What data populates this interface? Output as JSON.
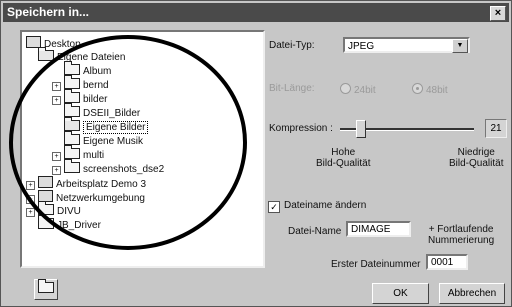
{
  "window": {
    "title": "Speichern in...",
    "close_glyph": "×"
  },
  "tree": {
    "items": [
      {
        "label": "Desktop",
        "icon": "desktop-icon"
      },
      {
        "label": "Eigene Dateien",
        "icon": "folder-open-icon"
      },
      {
        "label": "Album",
        "icon": "folder-icon"
      },
      {
        "label": "bernd",
        "icon": "folder-icon",
        "expander": "+"
      },
      {
        "label": "bilder",
        "icon": "folder-icon",
        "expander": "+"
      },
      {
        "label": "DSEII_Bilder",
        "icon": "folder-icon"
      },
      {
        "label": "Eigene Bilder",
        "icon": "folder-open-icon",
        "selected": true
      },
      {
        "label": "Eigene Musik",
        "icon": "folder-icon"
      },
      {
        "label": "multi",
        "icon": "folder-icon",
        "expander": "+"
      },
      {
        "label": "screenshots_dse2",
        "icon": "folder-icon",
        "expander": "+"
      },
      {
        "label": "Arbeitsplatz Demo 3",
        "icon": "computer-icon",
        "expander": "+"
      },
      {
        "label": "Netzwerkumgebung",
        "icon": "network-icon",
        "expander": "+"
      },
      {
        "label": "DIVU",
        "icon": "folder-icon",
        "expander": "+"
      },
      {
        "label": "JB_Driver",
        "icon": "folder-icon"
      }
    ]
  },
  "settings": {
    "file_type_label": "Datei-Typ:",
    "file_type_value": "JPEG",
    "bit_depth_label": "Bit-Länge:",
    "bit_24_label": "24bit",
    "bit_48_label": "48bit",
    "compression_label": "Kompression :",
    "compression_value": "21",
    "compression_fraction": 0.12,
    "high_quality_label": "Hohe\nBild-Qualität",
    "low_quality_label": "Niedrige\nBild-Qualität",
    "rename_label": "Dateiname ändern",
    "rename_checked": "✓",
    "filename_label": "Datei-Name",
    "filename_value": "DIMAGE",
    "numbering_label": "+ Fortlaufende\nNummerierung",
    "first_number_label": "Erster Dateinummer",
    "first_number_value": "0001"
  },
  "buttons": {
    "ok": "OK",
    "cancel": "Abbrechen",
    "new_folder_icon": "new-folder-icon"
  }
}
